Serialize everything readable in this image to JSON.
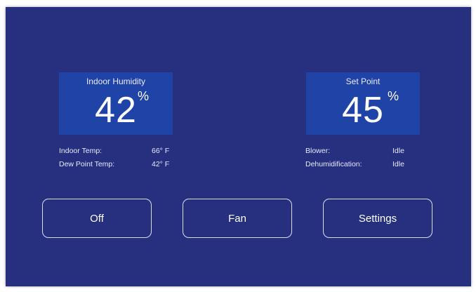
{
  "humidity_panel": {
    "label": "Indoor Humidity",
    "value": "42",
    "unit": "%"
  },
  "setpoint_panel": {
    "label": "Set Point",
    "value": "45",
    "unit": "%"
  },
  "left_info": {
    "indoor_temp_label": "Indoor Temp:",
    "indoor_temp_value": "66° F",
    "dew_point_label": "Dew Point Temp:",
    "dew_point_value": "42° F"
  },
  "right_info": {
    "blower_label": "Blower:",
    "blower_value": "Idle",
    "dehum_label": "Dehumidification:",
    "dehum_value": "Idle"
  },
  "buttons": {
    "off": "Off",
    "fan": "Fan",
    "settings": "Settings"
  },
  "colors": {
    "background": "#27307f",
    "panel": "#1f43a6",
    "button_border": "#d9ddf5"
  }
}
